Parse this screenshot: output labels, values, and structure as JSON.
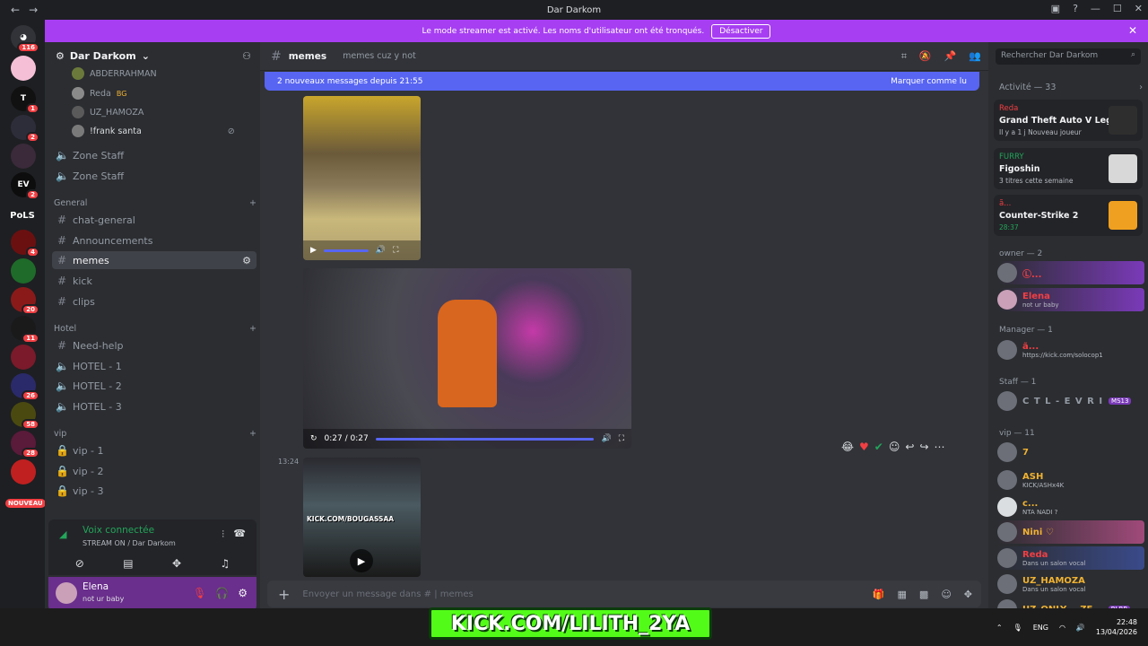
{
  "window": {
    "title": "Dar Darkom",
    "back": "←",
    "forward": "→"
  },
  "banner": {
    "text": "Le mode streamer est activé. Les noms d'utilisateur ont été tronqués.",
    "button": "Désactiver"
  },
  "servers": [
    {
      "label": "",
      "badge": "116"
    },
    {
      "label": "",
      "badge": ""
    },
    {
      "label": "T",
      "badge": "1"
    },
    {
      "label": "",
      "badge": "2"
    },
    {
      "label": "",
      "badge": ""
    },
    {
      "label": "EV",
      "badge": "2"
    },
    {
      "label": "PoLS",
      "badge": ""
    },
    {
      "label": "",
      "badge": "4"
    },
    {
      "label": "",
      "badge": ""
    },
    {
      "label": "",
      "badge": "20"
    },
    {
      "label": "",
      "badge": "11"
    },
    {
      "label": "",
      "badge": ""
    },
    {
      "label": "",
      "badge": "26"
    },
    {
      "label": "",
      "badge": "58"
    },
    {
      "label": "",
      "badge": "28"
    },
    {
      "label": "",
      "badge": ""
    },
    {
      "label": "NOUVEAU",
      "badge": ""
    }
  ],
  "sidebar": {
    "server_name": "Dar Darkom",
    "voice_users": [
      "ABDERRAHMAN",
      "Reda",
      "UZ_HAMOZA",
      "!frank santa"
    ],
    "badge_bg": "BG",
    "staff_channels": [
      "Zone Staff",
      "Zone Staff"
    ],
    "cat_general": "General",
    "general_channels": [
      "chat-general",
      "Announcements",
      "memes",
      "kick",
      "clips"
    ],
    "cat_hotel": "Hotel",
    "hotel_channels": [
      "Need-help",
      "HOTEL - 1",
      "HOTEL - 2",
      "HOTEL - 3"
    ],
    "cat_vip": "vip",
    "vip_channels": [
      "vip - 1",
      "vip - 2",
      "vip - 3"
    ]
  },
  "voice_panel": {
    "status": "Voix connectée",
    "location": "STREAM ON / Dar Darkom"
  },
  "user_panel": {
    "name": "Elena",
    "status": "not ur baby"
  },
  "channel": {
    "name": "memes",
    "topic": "memes cuz y not"
  },
  "new_messages": {
    "text": "2 nouveaux messages depuis 21:55",
    "mark": "Marquer comme lu"
  },
  "video": {
    "time": "0:27 / 0:27"
  },
  "message_time": "13:24",
  "thumbnail_text": "KICK.COM/BOUGASSAA",
  "composer": {
    "placeholder": "Envoyer un message dans # | memes"
  },
  "right": {
    "search_placeholder": "Rechercher Dar Darkom",
    "activity": "Activité — 33",
    "cards": [
      {
        "user": "Reda",
        "game": "Grand Theft Auto V Legacy",
        "meta": "Il y a 1 j  Nouveau joueur",
        "color": "#f23f43"
      },
      {
        "user": "FURRY",
        "game": "Figoshin",
        "meta": "3 titres cette semaine",
        "color": "#23a55a"
      },
      {
        "user": "ã...",
        "game": "Counter-Strike 2",
        "meta": "28:37",
        "color": "#f23f43"
      }
    ],
    "groups": {
      "owner": "owner — 2",
      "manager": "Manager — 1",
      "staff": "Staff — 1",
      "vip": "vip — 11"
    },
    "members": [
      {
        "name": "Ⓛ...",
        "sub": "",
        "color": "#f23f43"
      },
      {
        "name": "Elena",
        "sub": "not ur baby",
        "color": "#f23f43"
      },
      {
        "name": "ã...",
        "sub": "https://kick.com/solocop1",
        "color": "#f23f43"
      },
      {
        "name": "C T L - E V R I",
        "sub": "",
        "color": "#949ba4"
      },
      {
        "name": "7",
        "sub": "",
        "color": "#f0b232"
      },
      {
        "name": "ASH",
        "sub": "KICK/ASHx4K",
        "color": "#f0b232"
      },
      {
        "name": "c...",
        "sub": "NTA NADI ?",
        "color": "#f0b232"
      },
      {
        "name": "Nini ♡",
        "sub": "",
        "color": "#f0b232"
      },
      {
        "name": "Reda",
        "sub": "Dans un salon vocal",
        "color": "#f23f43"
      },
      {
        "name": "UZ_HAMOZA",
        "sub": "Dans un salon vocal",
        "color": "#f0b232"
      },
      {
        "name": "UZ_ONLY___ZE...",
        "sub": "",
        "color": "#f0b232"
      }
    ],
    "badge_ms13": "MS13",
    "badge_rlrp": "RLRP"
  },
  "overlay": {
    "kick_text": "KICK.COM/LILITH_2YA"
  },
  "tray": {
    "lang": "ENG",
    "time": "22:48",
    "date": "13/04/2026"
  }
}
